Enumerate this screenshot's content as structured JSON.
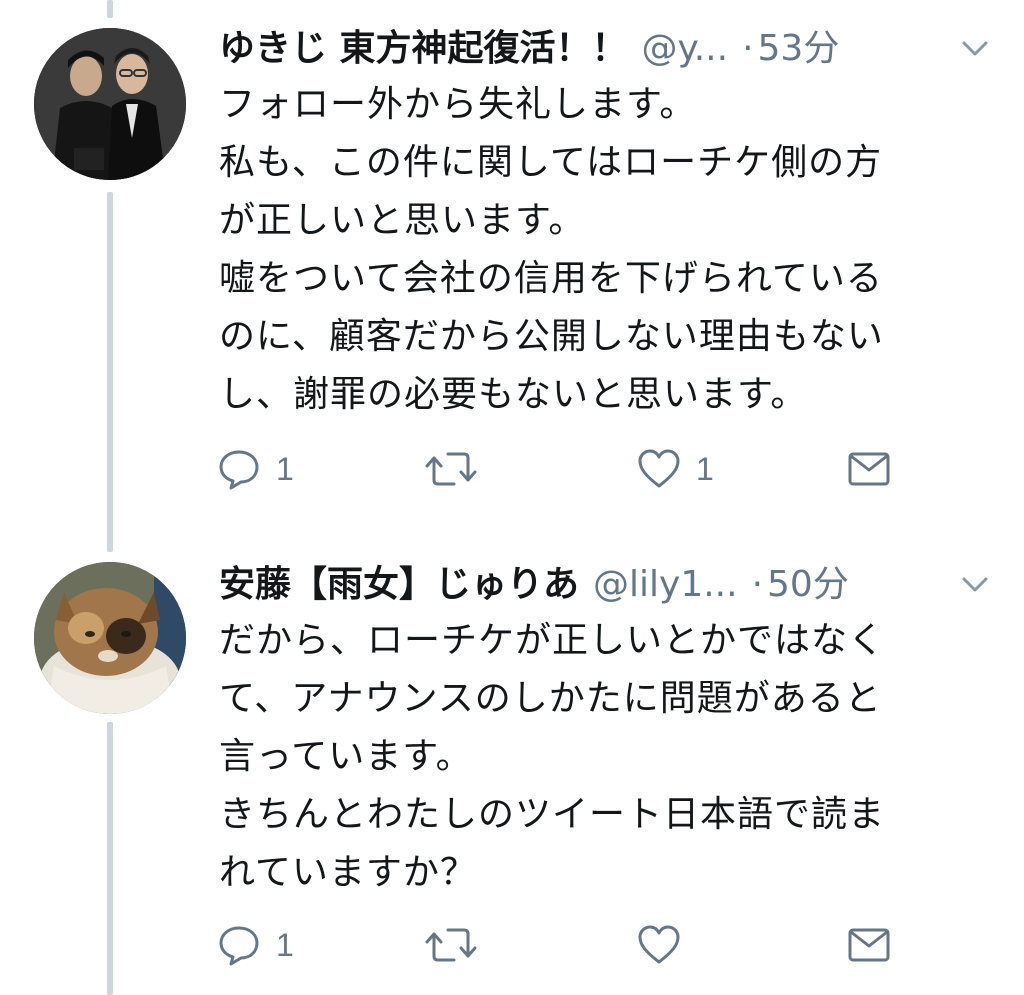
{
  "tweets": [
    {
      "display_name": "ゆきじ 東方神起復活！！",
      "handle": "@y...",
      "separator": "·",
      "time": "53分",
      "body_lines": [
        "フォロー外から失礼します。",
        "私も、この件に関してはローチケ側の方",
        "が正しいと思います。",
        "嘘をついて会社の信用を下げられている",
        "のに、顧客だから公開しない理由もない",
        "し、謝罪の必要もないと思います。"
      ],
      "reply_count": "1",
      "retweet_count": "",
      "like_count": "1",
      "avatar_icon": "avatar-two-men-photo"
    },
    {
      "display_name": "安藤【雨女】じゅりあ",
      "handle": "@lily1...",
      "separator": "·",
      "time": "50分",
      "body_lines": [
        "だから、ローチケが正しいとかではなく",
        "て、アナウンスのしかたに問題があると",
        "言っています。",
        "きちんとわたしのツイート日本語で読ま",
        "れていますか？"
      ],
      "reply_count": "1",
      "retweet_count": "",
      "like_count": "",
      "avatar_icon": "avatar-cat-photo"
    }
  ],
  "colors": {
    "text": "#14171a",
    "secondary": "#657786",
    "thread_line": "#ccd6dd"
  }
}
